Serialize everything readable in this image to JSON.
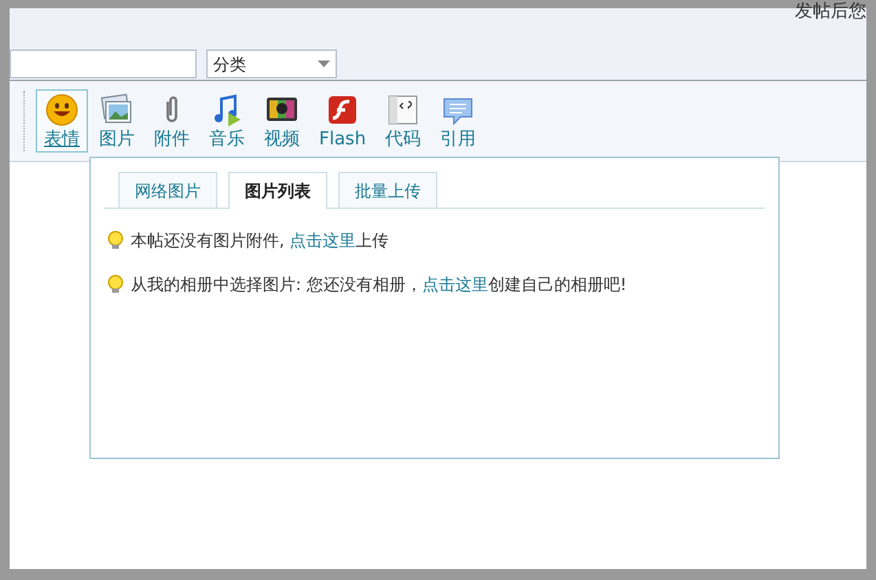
{
  "header": {
    "notice": "发帖后您"
  },
  "form": {
    "category": {
      "value": "分类"
    }
  },
  "toolbar": [
    {
      "label": "表情",
      "selected": true
    },
    {
      "label": "图片",
      "selected": false
    },
    {
      "label": "附件",
      "selected": false
    },
    {
      "label": "音乐",
      "selected": false
    },
    {
      "label": "视频",
      "selected": false
    },
    {
      "label": "Flash",
      "selected": false
    },
    {
      "label": "代码",
      "selected": false
    },
    {
      "label": "引用",
      "selected": false
    }
  ],
  "popup": {
    "tabs": [
      {
        "label": "网络图片",
        "selected": false
      },
      {
        "label": "图片列表",
        "selected": true
      },
      {
        "label": "批量上传",
        "selected": false
      }
    ],
    "hints": [
      {
        "before": "本帖还没有图片附件, ",
        "link": "点击这里",
        "after": "上传"
      },
      {
        "before": "从我的相册中选择图片: 您还没有相册，",
        "link": "点击这里",
        "after": "创建自己的相册吧!"
      }
    ]
  }
}
